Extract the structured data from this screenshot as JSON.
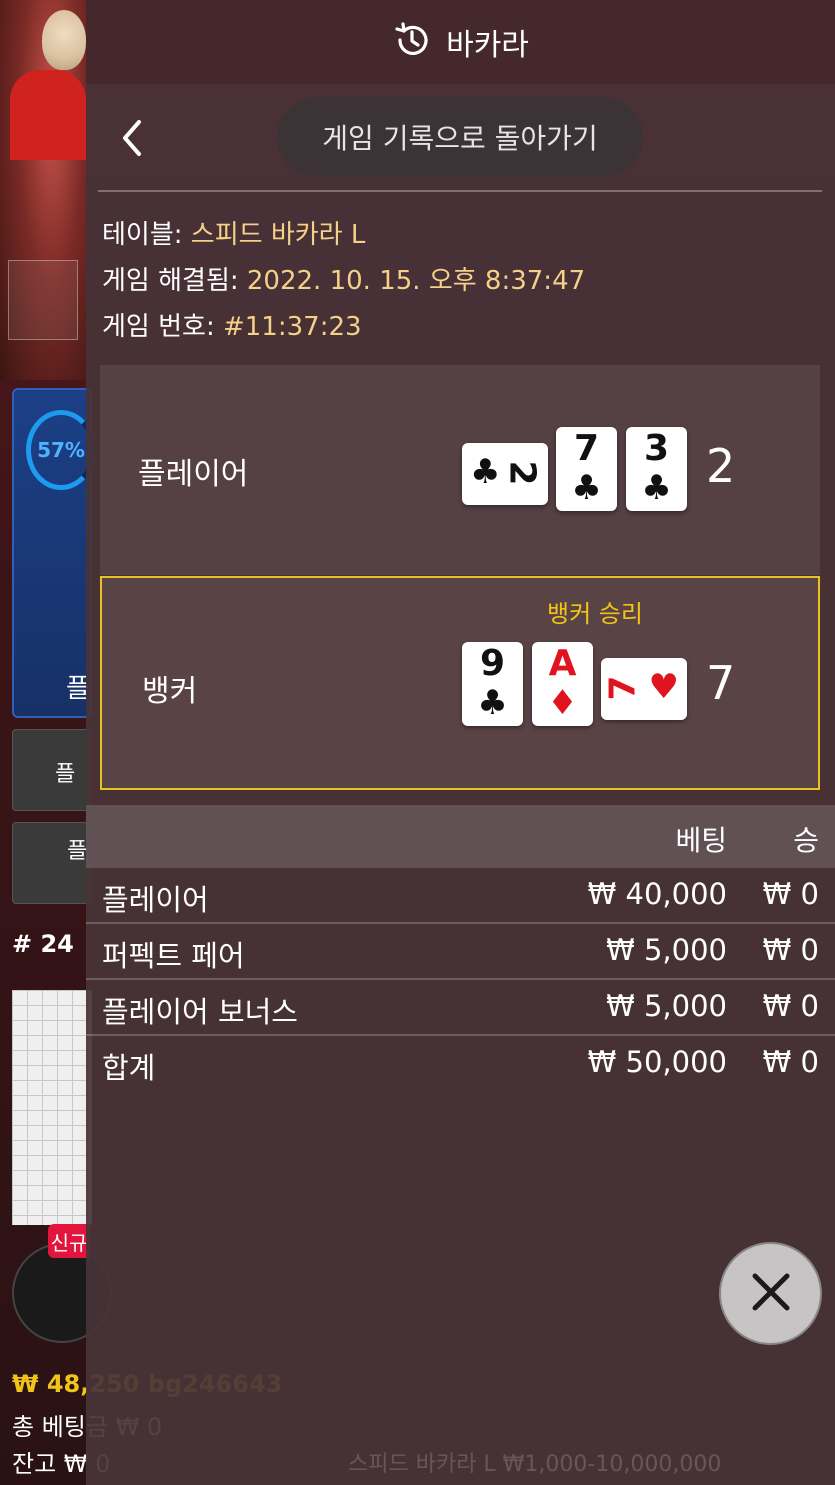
{
  "background": {
    "progress_percent": "57%",
    "player_partial_label": "플",
    "player_bonus_partial": "플",
    "player_pair_partial": "플",
    "round_label": "# 24",
    "new_badge": "신규",
    "balance_line": "₩ 48,250 bg246643",
    "total_bet_line": "총 베팅금 ₩ 0",
    "balance_label": "잔고 ₩ 0",
    "table_limit_line": "스피드 바카라 L ₩1,000-10,000,000"
  },
  "header": {
    "title": "바카라",
    "icon": "history-icon"
  },
  "nav": {
    "back_icon": "chevron-left-icon",
    "back_to_history_label": "게임 기록으로 돌아가기"
  },
  "meta": {
    "table_label": "테이블:",
    "table_value": "스피드 바카라 L",
    "resolved_label": "게임 해결됨:",
    "resolved_value": "2022. 10. 15. 오후 8:37:47",
    "game_no_label": "게임 번호:",
    "game_no_value": "#11:37:23"
  },
  "player_hand": {
    "label": "플레이어",
    "score": "2",
    "cards": [
      {
        "rank": "2",
        "suit": "♣",
        "orientation": "sideways",
        "color": "#111111"
      },
      {
        "rank": "7",
        "suit": "♣",
        "orientation": "upright",
        "color": "#111111"
      },
      {
        "rank": "3",
        "suit": "♣",
        "orientation": "upright",
        "color": "#111111"
      }
    ]
  },
  "banker_hand": {
    "label": "뱅커",
    "result_text": "뱅커 승리",
    "score": "7",
    "cards": [
      {
        "rank": "9",
        "suit": "♣",
        "orientation": "upright",
        "color": "#111111"
      },
      {
        "rank": "A",
        "suit": "♦",
        "orientation": "upright",
        "color": "#e0141f"
      },
      {
        "rank": "7",
        "suit": "♥",
        "orientation": "sideways",
        "color": "#e0141f"
      }
    ]
  },
  "bets": {
    "col_bet": "베팅",
    "col_win": "승",
    "rows": [
      {
        "name": "플레이어",
        "bet": "₩ 40,000",
        "win": "₩ 0"
      },
      {
        "name": "퍼펙트 페어",
        "bet": "₩ 5,000",
        "win": "₩ 0"
      },
      {
        "name": "플레이어 보너스",
        "bet": "₩ 5,000",
        "win": "₩ 0"
      }
    ],
    "total": {
      "name": "합계",
      "bet": "₩ 50,000",
      "win": "₩ 0"
    }
  },
  "close_icon": "close-icon",
  "colors": {
    "accent_gold": "#f0c419",
    "value_text": "#f4d089",
    "banker_win_border": "#e8c21e",
    "heart_diamond_red": "#e0141f"
  }
}
